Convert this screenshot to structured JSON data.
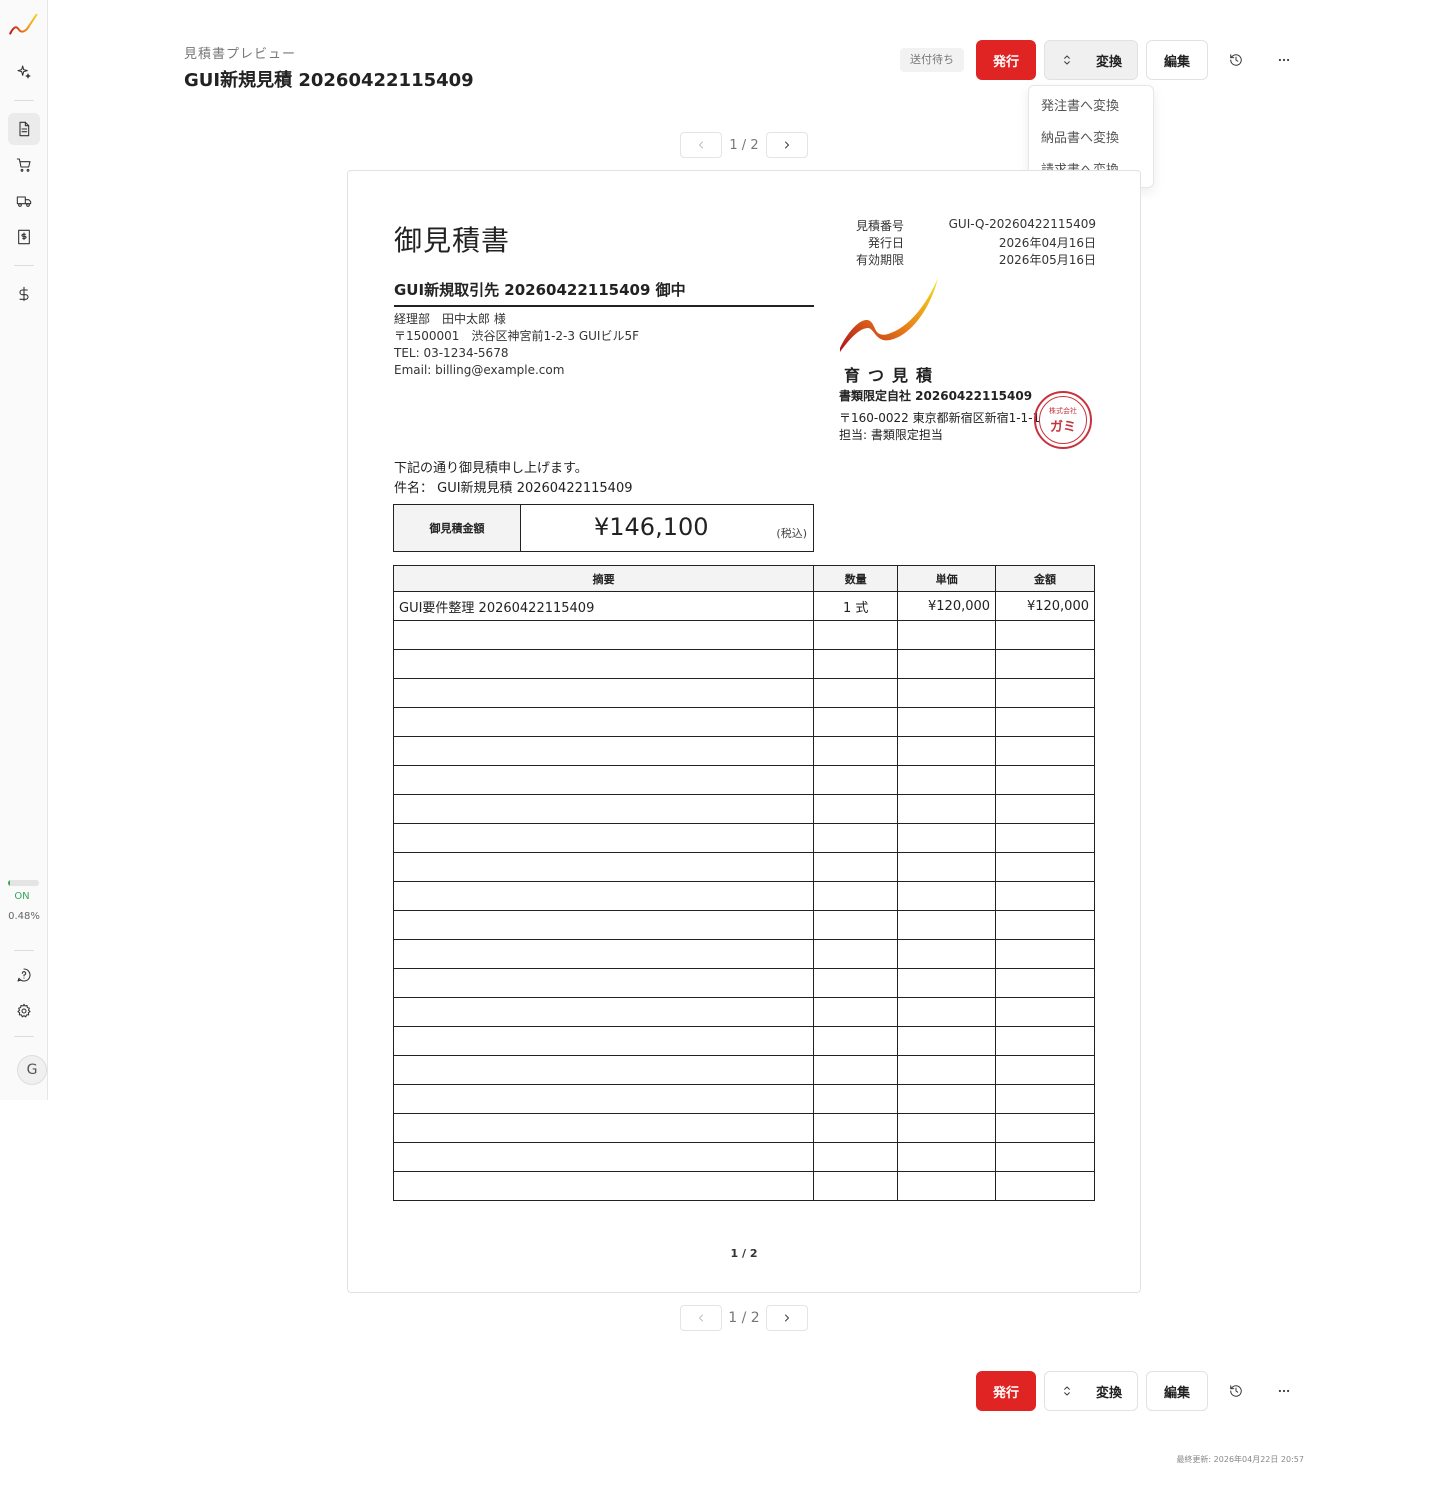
{
  "sidebar": {
    "status_on": "ON",
    "usage_pct": "0.48%",
    "usage_fraction": 0.05,
    "avatar_initial": "G",
    "icons": [
      "logo-icon",
      "sparkle-icon",
      "document-icon",
      "cart-icon",
      "truck-icon",
      "invoice-icon",
      "dollar-icon",
      "help-icon",
      "gear-icon"
    ]
  },
  "header": {
    "breadcrumb": "見積書プレビュー",
    "title": "GUI新規見積 20260422115409",
    "status": "送付待ち"
  },
  "actions": {
    "issue": "発行",
    "convert": "変換",
    "edit": "編集"
  },
  "convert_menu": [
    "発注書へ変換",
    "納品書へ変換",
    "請求書へ変換"
  ],
  "pager": {
    "label": "1 / 2"
  },
  "document": {
    "title": "御見積書",
    "meta": [
      {
        "label": "見積番号",
        "value": "GUI-Q-20260422115409"
      },
      {
        "label": "発行日",
        "value": "2026年04月16日"
      },
      {
        "label": "有効期限",
        "value": "2026年05月16日"
      }
    ],
    "recipient": "GUI新規取引先 20260422115409 御中",
    "recipient_lines": [
      "経理部　田中太郎 様",
      "〒1500001　渋谷区神宮前1-2-3 GUIビル5F",
      "TEL: 03-1234-5678",
      "Email: billing@example.com"
    ],
    "brand": "育つ見積",
    "company": "書類限定自社 20260422115409",
    "company_address": "〒160-0022 東京都新宿区新宿1-1-1",
    "company_contact": "担当: 書類限定担当",
    "seal_top": "株式会社",
    "seal_main": "ガミ",
    "intro": "下記の通り御見積申し上げます。",
    "subject": "件名：  GUI新規見積 20260422115409",
    "total_label": "御見積金額",
    "total_amount": "¥146,100",
    "tax_note": "(税込)",
    "table_headers": [
      "摘要",
      "数量",
      "単価",
      "金額"
    ],
    "rows": [
      [
        "GUI要件整理 20260422115409",
        "1 式",
        "¥120,000",
        "¥120,000"
      ]
    ],
    "empty_rows": 20,
    "page": "1 / 2"
  },
  "footer": {
    "updated": "最終更新: 2026年04月22日 20:57"
  },
  "colors": {
    "accent": "#e02424",
    "seal": "#c8323c",
    "status_green": "#3aa55a"
  }
}
